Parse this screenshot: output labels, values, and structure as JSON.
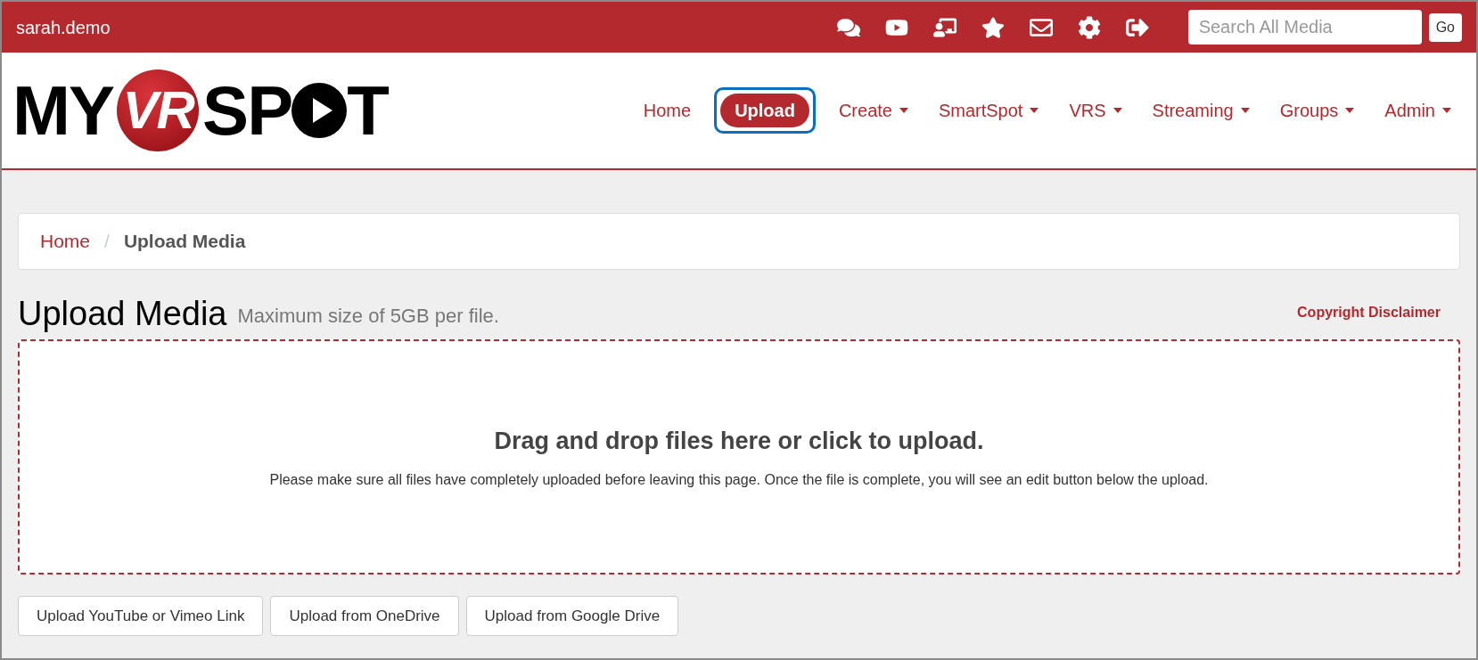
{
  "top_bar": {
    "username": "sarah.demo",
    "search": {
      "placeholder": "Search All Media"
    },
    "search_button": "Go"
  },
  "logo": {
    "part_1": "MY",
    "badge": "VR",
    "part_2": "SP",
    "part_3": "T"
  },
  "nav": [
    {
      "label": "Home",
      "selected": false,
      "dropdown": false,
      "highlighted": false
    },
    {
      "label": "Upload",
      "selected": true,
      "dropdown": false,
      "highlighted": true
    },
    {
      "label": "Create",
      "selected": false,
      "dropdown": true,
      "highlighted": false
    },
    {
      "label": "SmartSpot",
      "selected": false,
      "dropdown": true,
      "highlighted": false
    },
    {
      "label": "VRS",
      "selected": false,
      "dropdown": true,
      "highlighted": false
    },
    {
      "label": "Streaming",
      "selected": false,
      "dropdown": true,
      "highlighted": false
    },
    {
      "label": "Groups",
      "selected": false,
      "dropdown": true,
      "highlighted": false
    },
    {
      "label": "Admin",
      "selected": false,
      "dropdown": true,
      "highlighted": false
    }
  ],
  "breadcrumb": [
    "Home",
    "Upload Media"
  ],
  "breadcrumb_separator": "/",
  "page": {
    "title": "Upload Media",
    "subtitle": "Maximum size of 5GB per file.",
    "disclaimer_link": "Copyright Disclaimer"
  },
  "dropzone": {
    "heading": "Drag and drop files here or click to upload.",
    "note": "Please make sure all files have completely uploaded before leaving this page. Once the file is complete, you will see an edit button below the upload."
  },
  "buttons": [
    "Upload YouTube or Vimeo Link",
    "Upload from OneDrive",
    "Upload from Google Drive"
  ]
}
